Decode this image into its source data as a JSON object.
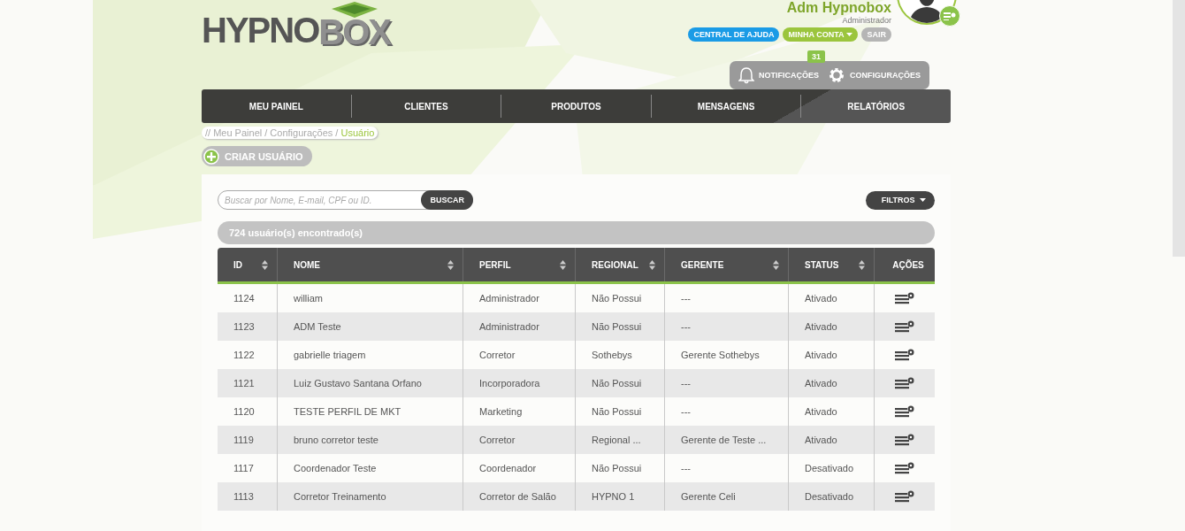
{
  "logo": {
    "text_1": "HYPNO",
    "text_2": "BOX"
  },
  "user": {
    "name": "Adm Hypnobox",
    "role": "Administrador",
    "links": [
      {
        "label": "CENTRAL DE AJUDA",
        "color": "#1a9be6",
        "dropdown": false
      },
      {
        "label": "MINHA CONTA",
        "color": "#9bc53d",
        "dropdown": true
      },
      {
        "label": "SAIR",
        "color": "#b5b5b5",
        "dropdown": false
      }
    ]
  },
  "toolbar": {
    "notifications": {
      "label": "NOTIFICAÇÕES",
      "count": "31"
    },
    "settings": {
      "label": "CONFIGURAÇÕES"
    }
  },
  "nav": {
    "items": [
      "MEU PAINEL",
      "CLIENTES",
      "PRODUTOS",
      "MENSAGENS",
      "RELATÓRIOS"
    ]
  },
  "breadcrumb": {
    "trail": "// Meu Painel / Configurações /",
    "current": "Usuário"
  },
  "create_button": "CRIAR USUÁRIO",
  "search": {
    "placeholder": "Buscar por Nome, E-mail, CPF ou ID.",
    "button": "BUSCAR"
  },
  "filters_button": "FILTROS",
  "result_count": "724 usuário(s) encontrado(s)",
  "table": {
    "columns": [
      {
        "label": "ID",
        "sortable": true
      },
      {
        "label": "NOME",
        "sortable": true
      },
      {
        "label": "PERFIL",
        "sortable": true
      },
      {
        "label": "REGIONAL",
        "sortable": true
      },
      {
        "label": "GERENTE",
        "sortable": true
      },
      {
        "label": "STATUS",
        "sortable": true
      },
      {
        "label": "AÇÕES",
        "sortable": false
      }
    ],
    "rows": [
      {
        "id": "1124",
        "name": "william",
        "profile": "Administrador",
        "regional": "Não Possui",
        "manager": "---",
        "status": "Ativado"
      },
      {
        "id": "1123",
        "name": "ADM Teste",
        "profile": "Administrador",
        "regional": "Não Possui",
        "manager": "---",
        "status": "Ativado"
      },
      {
        "id": "1122",
        "name": "gabrielle triagem",
        "profile": "Corretor",
        "regional": "Sothebys",
        "manager": "Gerente Sothebys",
        "status": "Ativado"
      },
      {
        "id": "1121",
        "name": "Luiz Gustavo Santana Orfano",
        "profile": "Incorporadora",
        "regional": "Não Possui",
        "manager": "---",
        "status": "Ativado"
      },
      {
        "id": "1120",
        "name": "TESTE PERFIL DE MKT",
        "profile": "Marketing",
        "regional": "Não Possui",
        "manager": "---",
        "status": "Ativado"
      },
      {
        "id": "1119",
        "name": "bruno corretor teste",
        "profile": "Corretor",
        "regional": "Regional ...",
        "manager": "Gerente de Teste ...",
        "status": "Ativado"
      },
      {
        "id": "1117",
        "name": "Coordenador Teste",
        "profile": "Coordenador",
        "regional": "Não Possui",
        "manager": "---",
        "status": "Desativado"
      },
      {
        "id": "1113",
        "name": "Corretor Treinamento",
        "profile": "Corretor de Salão",
        "regional": "HYPNO 1",
        "manager": "Gerente Celi",
        "status": "Desativado"
      }
    ]
  }
}
